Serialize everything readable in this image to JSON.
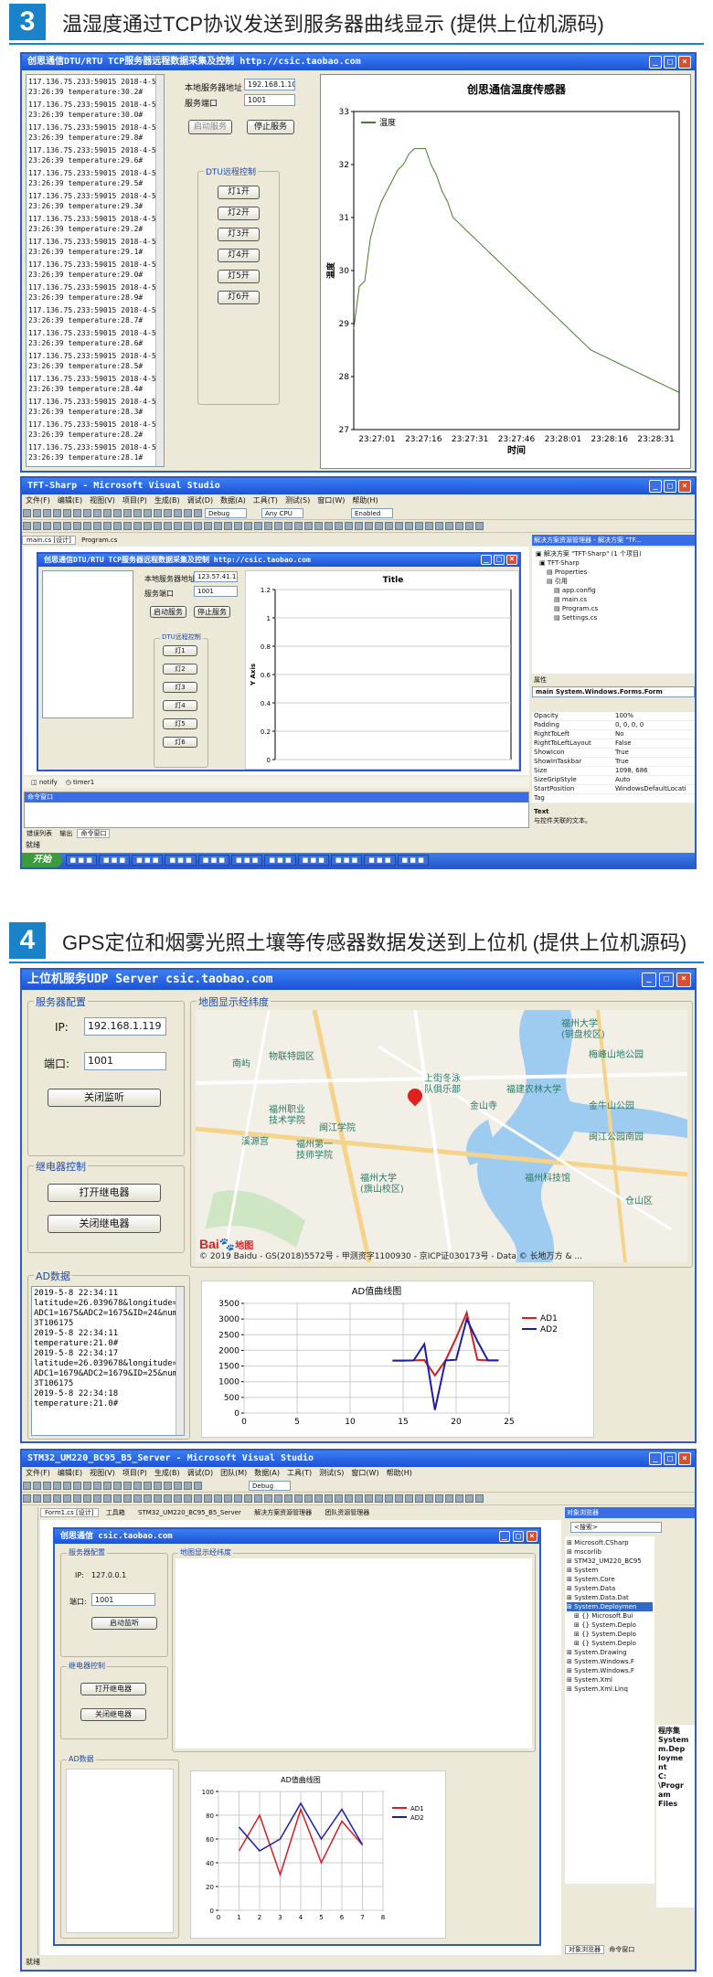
{
  "sections": [
    {
      "num": "3",
      "title": "温湿度通过TCP协议发送到服务器曲线显示 (提供上位机源码)"
    },
    {
      "num": "4",
      "title": "GPS定位和烟雾光照土壤等传感器数据发送到上位机 (提供上位机源码)"
    }
  ],
  "colors": {
    "accent": "#1a82c8",
    "titlebar": "#2a5bc8",
    "series_green": "#4a7a2a",
    "series_red": "#d02020",
    "series_blue": "#1c1ca8"
  },
  "w1": {
    "title": "创思通信DTU/RTU TCP服务器远程数据采集及控制  http://csic.taobao.com",
    "log": [
      [
        "117.136.75.233:59015  2018-4-5",
        "23:26:39   temperature:30.2#"
      ],
      [
        "117.136.75.233:59015  2018-4-5",
        "23:26:39   temperature:30.0#"
      ],
      [
        "117.136.75.233:59015  2018-4-5",
        "23:26:39   temperature:29.8#"
      ],
      [
        "117.136.75.233:59015  2018-4-5",
        "23:26:39   temperature:29.6#"
      ],
      [
        "117.136.75.233:59015  2018-4-5",
        "23:26:39   temperature:29.5#"
      ],
      [
        "117.136.75.233:59015  2018-4-5",
        "23:26:39   temperature:29.3#"
      ],
      [
        "117.136.75.233:59015  2018-4-5",
        "23:26:39   temperature:29.2#"
      ],
      [
        "117.136.75.233:59015  2018-4-5",
        "23:26:39   temperature:29.1#"
      ],
      [
        "117.136.75.233:59015  2018-4-5",
        "23:26:39   temperature:29.0#"
      ],
      [
        "117.136.75.233:59015  2018-4-5",
        "23:26:39   temperature:28.9#"
      ],
      [
        "117.136.75.233:59015  2018-4-5",
        "23:26:39   temperature:28.7#"
      ],
      [
        "117.136.75.233:59015  2018-4-5",
        "23:26:39   temperature:28.6#"
      ],
      [
        "117.136.75.233:59015  2018-4-5",
        "23:26:39   temperature:28.5#"
      ],
      [
        "117.136.75.233:59015  2018-4-5",
        "23:26:39   temperature:28.4#"
      ],
      [
        "117.136.75.233:59015  2018-4-5",
        "23:26:39   temperature:28.3#"
      ],
      [
        "117.136.75.233:59015  2018-4-5",
        "23:26:39   temperature:28.2#"
      ],
      [
        "117.136.75.233:59015  2018-4-5",
        "23:26:39   temperature:28.1#"
      ],
      [
        "117.136.75.233:59015  2018-4-5",
        "23:26:39   temperature:28.0#"
      ]
    ],
    "ip_label": "本地服务器地址",
    "ip_value": "192.168.1.100",
    "port_label": "服务端口",
    "port_value": "1001",
    "start_btn": "启动服务",
    "stop_btn": "停止服务",
    "ctrl_group": "DTU远程控制",
    "lights": [
      "灯1开",
      "灯2开",
      "灯3开",
      "灯4开",
      "灯5开",
      "灯6开"
    ]
  },
  "vs1": {
    "title": "TFT-Sharp - Microsoft Visual Studio",
    "menu": [
      "文件(F)",
      "编辑(E)",
      "视图(V)",
      "项目(P)",
      "生成(B)",
      "调试(D)",
      "数据(A)",
      "工具(T)",
      "测试(S)",
      "窗口(W)",
      "帮助(H)"
    ],
    "config": "Debug",
    "platform": "Any CPU",
    "enabled": "Enabled",
    "tabs": [
      "main.cs [设计]",
      "Program.cs"
    ],
    "inner_title": "创思通信DTU/RTU TCP服务器远程数据采集及控制  http://csic.taobao.com",
    "ip_label": "本地服务器地址",
    "ip_value": "123.57.41.13",
    "port_label": "服务端口",
    "port_value": "1001",
    "start_btn": "启动服务",
    "stop_btn": "停止服务",
    "ctrl_group": "DTU远程控制",
    "lights": [
      "灯1",
      "灯2",
      "灯3",
      "灯4",
      "灯5",
      "灯6"
    ],
    "tray": [
      "notify",
      "timer1"
    ],
    "cmd_title": "命令窗口",
    "bottom_tabs": [
      "错误列表",
      "输出",
      "命令窗口"
    ],
    "status": "就绪",
    "sol_title": "解决方案资源管理器 - 解决方案 \"TF...",
    "sol_tree": [
      "解决方案 \"TFT-Sharp\" (1 个项目)",
      "TFT-Sharp",
      "Properties",
      "引用",
      "app.config",
      "main.cs",
      "Program.cs",
      "Settings.cs"
    ],
    "props_title": "属性",
    "props_object": "main System.Windows.Forms.Form",
    "props": [
      [
        "Opacity",
        "100%"
      ],
      [
        "Padding",
        "0, 0, 0, 0"
      ],
      [
        "RightToLeft",
        "No"
      ],
      [
        "RightToLeftLayout",
        "False"
      ],
      [
        "ShowIcon",
        "True"
      ],
      [
        "ShowInTaskbar",
        "True"
      ],
      [
        "Size",
        "1098, 686"
      ],
      [
        "SizeGripStyle",
        "Auto"
      ],
      [
        "StartPosition",
        "WindowsDefaultLocati"
      ],
      [
        "Tag",
        ""
      ],
      [
        "Text",
        "创思通信DTU/RTU TC"
      ]
    ],
    "props_desc_title": "Text",
    "props_desc": "与控件关联的文本。",
    "start_menu": "开始"
  },
  "w2": {
    "title": "上位机服务UDP Server csic.taobao.com",
    "cfg_group": "服务器配置",
    "ip_label": "IP:",
    "ip_value": "192.168.1.119",
    "port_label": "端口:",
    "port_value": "1001",
    "close_btn": "关闭监听",
    "relay_group": "继电器控制",
    "relay_on": "打开继电器",
    "relay_off": "关闭继电器",
    "map_group": "地图显示经纬度",
    "map_labels": [
      "福州大学",
      "(铜盘校区)",
      "梅峰山地公园",
      "物联特园区",
      "上街冬泳",
      "队俱乐部",
      "福建农林大学",
      "金山寺",
      "金牛山公园",
      "福州职业",
      "技术学院",
      "闽江学院",
      "闽江公园南园",
      "溪源宫",
      "福州第一",
      "技师学院",
      "福州大学",
      "(旗山校区)",
      "福州科技馆",
      "仓山区",
      "南屿"
    ],
    "map_copyright": "© 2019 Baidu - GS(2018)5572号 - 甲测资字1100930 - 京ICP证030173号 - Data © 长地万方 & ...",
    "baidu": "Bai",
    "baidu2": "地图",
    "ad_group": "AD数据",
    "ad_log": [
      "2019-5-8 22:34:11",
      "latitude=26.039678&longitude=119.124107&",
      "ADC1=1675&ADC2=1675&ID=24&number=4600424",
      "3T106175",
      "2019-5-8 22:34:11",
      "temperature:21.0#",
      "2019-5-8 22:34:17",
      "latitude=26.039678&longitude=119.124107&",
      "ADC1=1679&ADC2=1679&ID=25&number=4600424",
      "3T106175",
      "2019-5-8 22:34:18",
      "temperature:21.0#"
    ]
  },
  "vs2": {
    "title": "STM32_UM220_BC95_B5_Server - Microsoft Visual Studio",
    "menu": [
      "文件(F)",
      "编辑(E)",
      "视图(V)",
      "项目(P)",
      "生成(B)",
      "调试(D)",
      "团队(M)",
      "数据(A)",
      "工具(T)",
      "测试(S)",
      "窗口(W)",
      "帮助(H)"
    ],
    "config": "Debug",
    "tabs": [
      "Form1.cs [设计]",
      "工具箱",
      "STM32_UM220_BC95_B5_Server",
      "解决方案资源管理器",
      "团队资源管理器"
    ],
    "inner_title": "创思通信  csic.taobao.com",
    "cfg_group": "服务器配置",
    "ip_label": "IP:",
    "ip_value": "127.0.0.1",
    "port_label": "端口:",
    "port_value": "1001",
    "listen_btn": "启动监听",
    "relay_group": "继电器控制",
    "relay_on": "打开继电器",
    "relay_off": "关闭继电器",
    "map_group": "地图显示经纬度",
    "ad_group": "AD数据",
    "obj_title": "对象浏览器",
    "obj_search": "<搜索>",
    "obj_tree": [
      "Microsoft.CSharp",
      "mscorlib",
      "STM32_UM220_BC95",
      "System",
      "System.Core",
      "System.Data",
      "System.Data.Dat",
      "System.Deploymen",
      "{} Microsoft.Bui",
      "{} System.Deplo",
      "{} System.Deplo",
      "{} System.Deplo",
      "System.Drawing",
      "System.Windows.F",
      "System.Windows.F",
      "System.Xml",
      "System.Xml.Linq"
    ],
    "detail": [
      "程序集",
      "System",
      "m.Dep",
      "loyme",
      "nt",
      "C:",
      "\\Progr",
      "am",
      "Files"
    ],
    "bottom_tabs": [
      "对象浏览器",
      "命令窗口"
    ],
    "status": "就绪"
  },
  "chart_data": [
    {
      "type": "line",
      "title": "创思通信温度传感器",
      "xlabel": "时间",
      "ylabel": "温度",
      "legend": [
        "温度"
      ],
      "legend_position": "top-left",
      "x_ticks": [
        "23:27:01",
        "23:27:16",
        "23:27:31",
        "23:27:46",
        "23:28:01",
        "23:28:16",
        "23:28:31"
      ],
      "ylim": [
        27,
        33
      ],
      "y_ticks": [
        27,
        28,
        29,
        30,
        31,
        32,
        33
      ],
      "series": [
        {
          "name": "温度",
          "values": [
            28.9,
            29.7,
            29.8,
            30.6,
            31.0,
            31.3,
            31.5,
            31.7,
            31.9,
            32.0,
            32.2,
            32.3,
            32.3,
            32.3,
            32.0,
            31.8,
            31.5,
            31.3,
            31.0,
            30.9,
            30.8,
            30.7,
            30.6,
            30.5,
            30.4,
            30.3,
            30.2,
            30.1,
            30.0,
            29.9,
            29.8,
            29.7,
            29.6,
            29.5,
            29.4,
            29.3,
            29.2,
            29.1,
            29.0,
            28.9,
            28.8,
            28.7,
            28.6,
            28.5,
            28.45,
            28.4,
            28.35,
            28.3,
            28.25,
            28.2,
            28.15,
            28.1,
            28.05,
            28.0,
            27.95,
            27.9,
            27.85,
            27.8,
            27.75,
            27.7
          ]
        }
      ],
      "grid": false
    },
    {
      "type": "line",
      "title": "Title",
      "ylabel": "Y Axis",
      "ylim": [
        0,
        1.2
      ],
      "y_ticks": [
        0,
        0.2,
        0.4,
        0.6,
        0.8,
        1.0,
        1.2
      ],
      "series": [],
      "grid": true
    },
    {
      "type": "line",
      "title": "AD值曲线图",
      "legend": [
        "AD1",
        "AD2"
      ],
      "legend_position": "right",
      "xlim": [
        0,
        25
      ],
      "x_ticks": [
        0,
        5,
        10,
        15,
        20,
        25
      ],
      "ylim": [
        0,
        3500
      ],
      "y_ticks": [
        0,
        500,
        1000,
        1500,
        2000,
        2500,
        3000,
        3500
      ],
      "series": [
        {
          "name": "AD1",
          "x": [
            14,
            15,
            16,
            17,
            18,
            19,
            20,
            21,
            22,
            23,
            24
          ],
          "values": [
            1675,
            1675,
            1679,
            1690,
            1200,
            1679,
            2400,
            3200,
            1700,
            1679,
            1679
          ]
        },
        {
          "name": "AD2",
          "x": [
            14,
            15,
            16,
            17,
            18,
            19,
            20,
            21,
            22,
            23,
            24
          ],
          "values": [
            1675,
            1675,
            1679,
            2200,
            100,
            1679,
            1700,
            3000,
            2300,
            1679,
            1679
          ]
        }
      ],
      "grid": true
    },
    {
      "type": "line",
      "title": "AD值曲线图",
      "legend": [
        "AD1",
        "AD2"
      ],
      "legend_position": "right",
      "xlim": [
        0,
        8
      ],
      "x_ticks": [
        0,
        1,
        2,
        3,
        4,
        5,
        6,
        7,
        8
      ],
      "ylim": [
        0,
        100
      ],
      "y_ticks": [
        0,
        20,
        40,
        60,
        80,
        100
      ],
      "series": [
        {
          "name": "AD1",
          "x": [
            1,
            2,
            3,
            4,
            5,
            6,
            7
          ],
          "values": [
            50,
            80,
            30,
            85,
            40,
            75,
            55
          ]
        },
        {
          "name": "AD2",
          "x": [
            1,
            2,
            3,
            4,
            5,
            6,
            7
          ],
          "values": [
            70,
            50,
            60,
            90,
            60,
            85,
            55
          ]
        }
      ],
      "grid": true
    }
  ]
}
